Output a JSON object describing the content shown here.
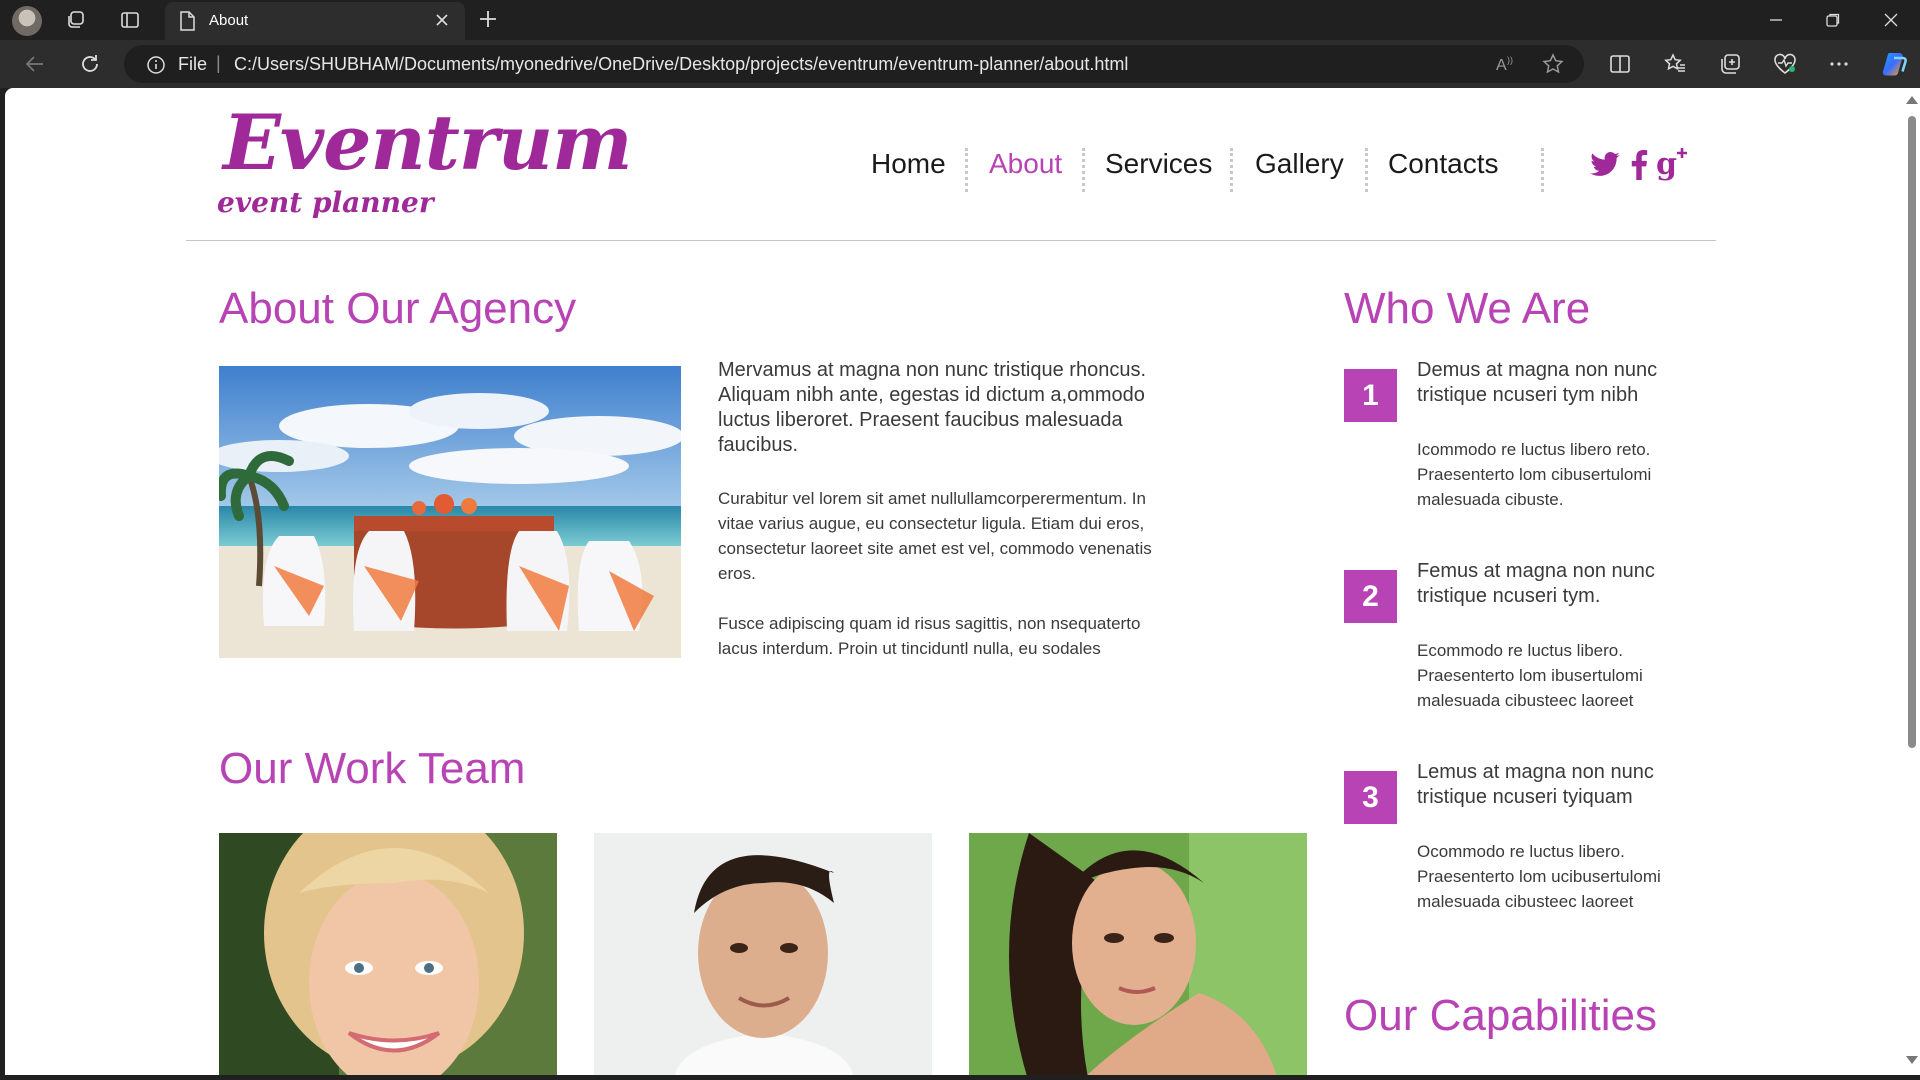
{
  "browser": {
    "tab_title": "About",
    "address_scheme": "File",
    "url": "C:/Users/SHUBHAM/Documents/myonedrive/OneDrive/Desktop/projects/eventrum/eventrum-planner/about.html",
    "icons": [
      "profile-avatar",
      "workspaces-icon",
      "tab-actions-icon",
      "page-icon",
      "close-icon",
      "new-tab-icon",
      "minimize-icon",
      "restore-icon",
      "window-close-icon",
      "back-icon",
      "refresh-icon",
      "info-icon",
      "read-aloud-icon",
      "favorite-star-icon",
      "split-screen-icon",
      "favorites-icon",
      "collections-icon",
      "browser-essentials-icon",
      "more-icon",
      "copilot-icon"
    ]
  },
  "site": {
    "logo": {
      "name": "Eventrum",
      "tagline": "event planner"
    },
    "nav": {
      "items": [
        {
          "label": "Home",
          "active": false
        },
        {
          "label": "About",
          "active": true
        },
        {
          "label": "Services",
          "active": false
        },
        {
          "label": "Gallery",
          "active": false
        },
        {
          "label": "Contacts",
          "active": false
        }
      ]
    },
    "social": [
      "twitter-icon",
      "facebook-icon",
      "google-plus-icon"
    ],
    "colors": {
      "accent": "#b743b5",
      "logo": "#a0299a",
      "text": "#3a3a3a"
    },
    "about": {
      "heading": "About Our Agency",
      "image": "beach-wedding-table-photo",
      "lead": "Mervamus at magna non nunc tristique rhoncus. Aliquam nibh ante, egestas id dictum a,ommodo luctus liberoret. Praesent faucibus malesuada faucibus.",
      "p1": "Curabitur vel lorem sit amet nullullamcorperermentum. In vitae varius augue, eu consectetur ligula. Etiam dui eros, consectetur laoreet site amet est vel, commodo venenatis eros.",
      "p2": "Fusce adipiscing quam id risus sagittis, non nsequaterto lacus interdum. Proin ut tinciduntl nulla, eu sodales"
    },
    "team": {
      "heading": "Our Work Team",
      "photos": [
        "team-member-1-photo",
        "team-member-2-photo",
        "team-member-3-photo"
      ]
    },
    "who": {
      "heading": "Who We Are",
      "items": [
        {
          "num": "1",
          "title": "Demus at magna non nunc tristique ncuseri tym nibh",
          "text": "Icommodo re luctus libero reto. Praesenterto lom cibusertulomi malesuada cibuste."
        },
        {
          "num": "2",
          "title": "Femus at magna non nunc tristique ncuseri tym.",
          "text": "Ecommodo re luctus libero. Praesenterto lom ibusertulomi malesuada cibusteec laoreet"
        },
        {
          "num": "3",
          "title": "Lemus at magna non nunc tristique ncuseri tyiquam",
          "text": "Ocommodo re luctus libero. Praesenterto lom ucibusertulomi malesuada cibusteec laoreet"
        }
      ]
    },
    "capabilities": {
      "heading": "Our Capabilities"
    }
  }
}
